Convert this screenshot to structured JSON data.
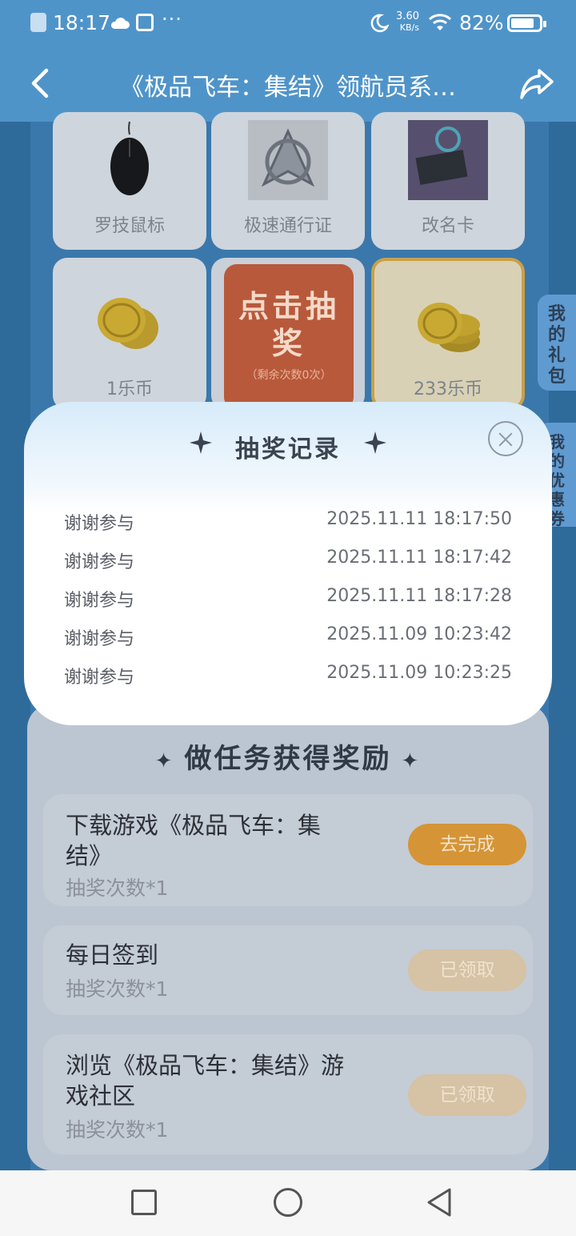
{
  "status_bar": {
    "time": "18:17",
    "dots": "···",
    "speed_value": "3.60",
    "speed_unit": "KB/s",
    "battery_pct": "82%",
    "battery_level": 0.82
  },
  "nav": {
    "title": "《极品飞车：集结》领航员系…"
  },
  "prizes": [
    {
      "label": "罗技鼠标"
    },
    {
      "label": "极速通行证"
    },
    {
      "label": "改名卡"
    },
    {
      "label": "1乐币"
    },
    {
      "label": "233乐币"
    }
  ],
  "draw_button": {
    "main": "点击抽奖",
    "sub": "（剩余次数0次）"
  },
  "side_tabs": {
    "gift": "我的礼包",
    "coupon": "我的优惠券"
  },
  "modal": {
    "title": "抽奖记录",
    "records": [
      {
        "name": "谢谢参与",
        "time": "2025.11.11 18:17:50"
      },
      {
        "name": "谢谢参与",
        "time": "2025.11.11 18:17:42"
      },
      {
        "name": "谢谢参与",
        "time": "2025.11.11 18:17:28"
      },
      {
        "name": "谢谢参与",
        "time": "2025.11.09 10:23:42"
      },
      {
        "name": "谢谢参与",
        "time": "2025.11.09 10:23:25"
      }
    ]
  },
  "tasks": {
    "title": "做任务获得奖励",
    "items": [
      {
        "name": "下载游戏《极品飞车：集结》",
        "sub": "抽奖次数*1",
        "button": "去完成"
      },
      {
        "name": "每日签到",
        "sub": "抽奖次数*1",
        "button": "已领取"
      },
      {
        "name": "浏览《极品飞车：集结》游戏社区",
        "sub": "抽奖次数*1",
        "button": "已领取"
      }
    ]
  },
  "colors": {
    "header": "#4f94c9",
    "accent_orange": "#d59436"
  }
}
